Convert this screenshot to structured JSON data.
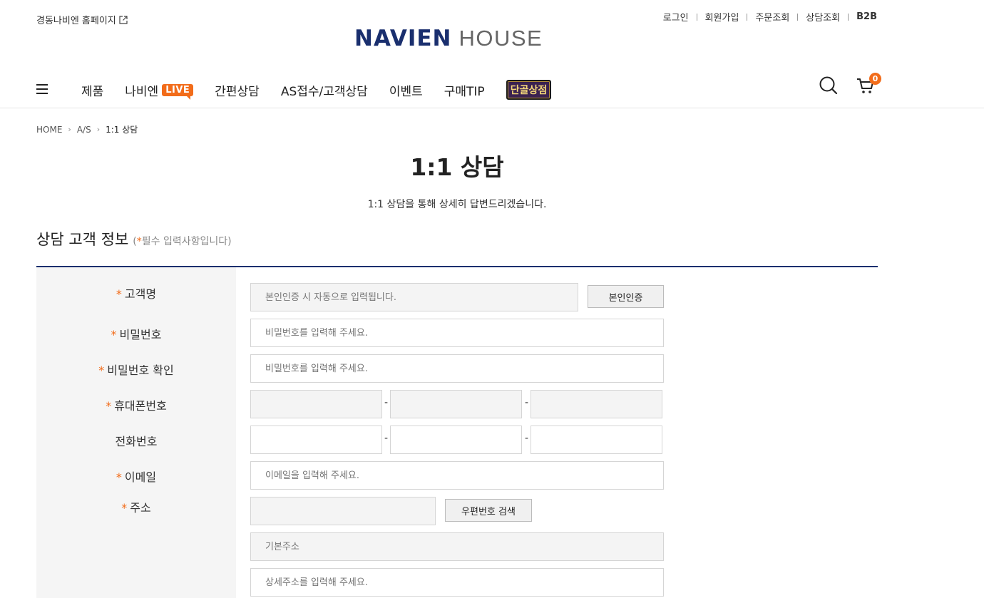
{
  "header": {
    "home_link": "경동나비엔 홈페이지",
    "util_nav": [
      "로그인",
      "회원가입",
      "주문조회",
      "상담조회",
      "B2B"
    ],
    "logo_brand": "NAVIEN",
    "logo_sub": "HOUSE"
  },
  "gnb": {
    "menu": [
      "제품",
      "나비엔",
      "간편상담",
      "AS접수/고객상담",
      "이벤트",
      "구매TIP"
    ],
    "live_badge": "LIVE",
    "special_badge": "단골상점",
    "cart_count": "0"
  },
  "breadcrumb": [
    "HOME",
    "A/S",
    "1:1 상담"
  ],
  "page": {
    "title": "1:1 상담",
    "desc": "1:1 상담을 통해 상세히 답변드리겠습니다."
  },
  "section": {
    "title": "상담 고객 정보",
    "note_open": "(",
    "note_star": "*",
    "note_text": "필수 입력사항입니다)"
  },
  "form": {
    "required_mark": "*",
    "labels": {
      "name": "고객명",
      "password": "비밀번호",
      "password_confirm": "비밀번호 확인",
      "mobile": "휴대폰번호",
      "phone": "전화번호",
      "email": "이메일",
      "address": "주소"
    },
    "placeholders": {
      "name": "본인인증 시 자동으로 입력됩니다.",
      "password": "비밀번호를 입력해 주세요.",
      "password_confirm": "비밀번호를 입력해 주세요.",
      "email": "이메일을 입력해 주세요.",
      "address_basic": "기본주소",
      "address_detail": "상세주소를 입력해 주세요."
    },
    "dash": "-",
    "buttons": {
      "verify": "본인인증",
      "zip_search": "우편번호 검색"
    }
  }
}
